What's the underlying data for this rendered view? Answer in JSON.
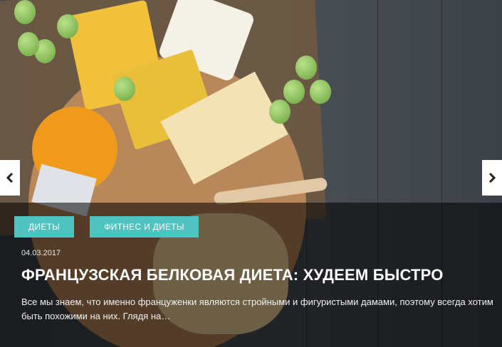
{
  "slide": {
    "tags": [
      "ДИЕТЫ",
      "ФИТНЕС И ДИЕТЫ"
    ],
    "date": "04.03.2017",
    "title": "ФРАНЦУЗСКАЯ БЕЛКОВАЯ ДИЕТА: ХУДЕЕМ БЫСТРО",
    "excerpt": "Все мы знаем, что именно француженки являются стройными и фигуристыми дамами, поэтому всегда хотим быть похожими на них. Глядя на…"
  },
  "icons": {
    "prev": "chevron-left-icon",
    "next": "chevron-right-icon"
  },
  "colors": {
    "tag_bg": "#4fc3c0",
    "overlay": "rgba(0,0,0,0.55)"
  }
}
